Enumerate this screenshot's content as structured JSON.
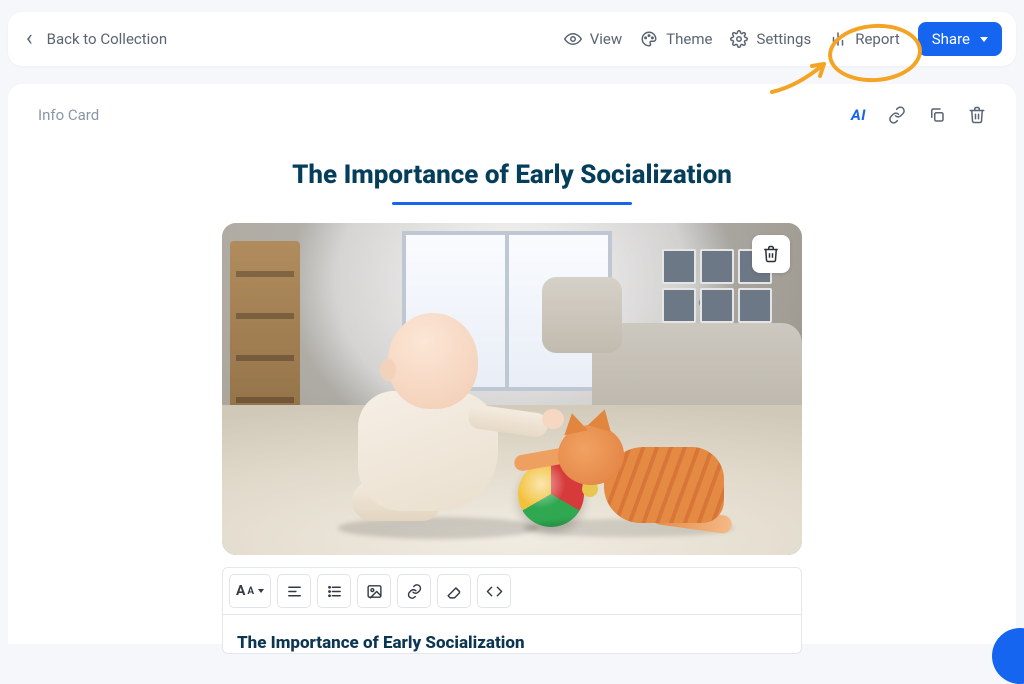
{
  "header": {
    "back_label": "Back to Collection",
    "view_label": "View",
    "theme_label": "Theme",
    "settings_label": "Settings",
    "report_label": "Report",
    "share_label": "Share"
  },
  "card": {
    "type_label": "Info Card",
    "title": "The Importance of Early Socialization",
    "ai_label": "AI",
    "image_alt": "Baby and orange kitten playing on a rug in a living room"
  },
  "editor": {
    "heading": "The Importance of Early Socialization"
  }
}
